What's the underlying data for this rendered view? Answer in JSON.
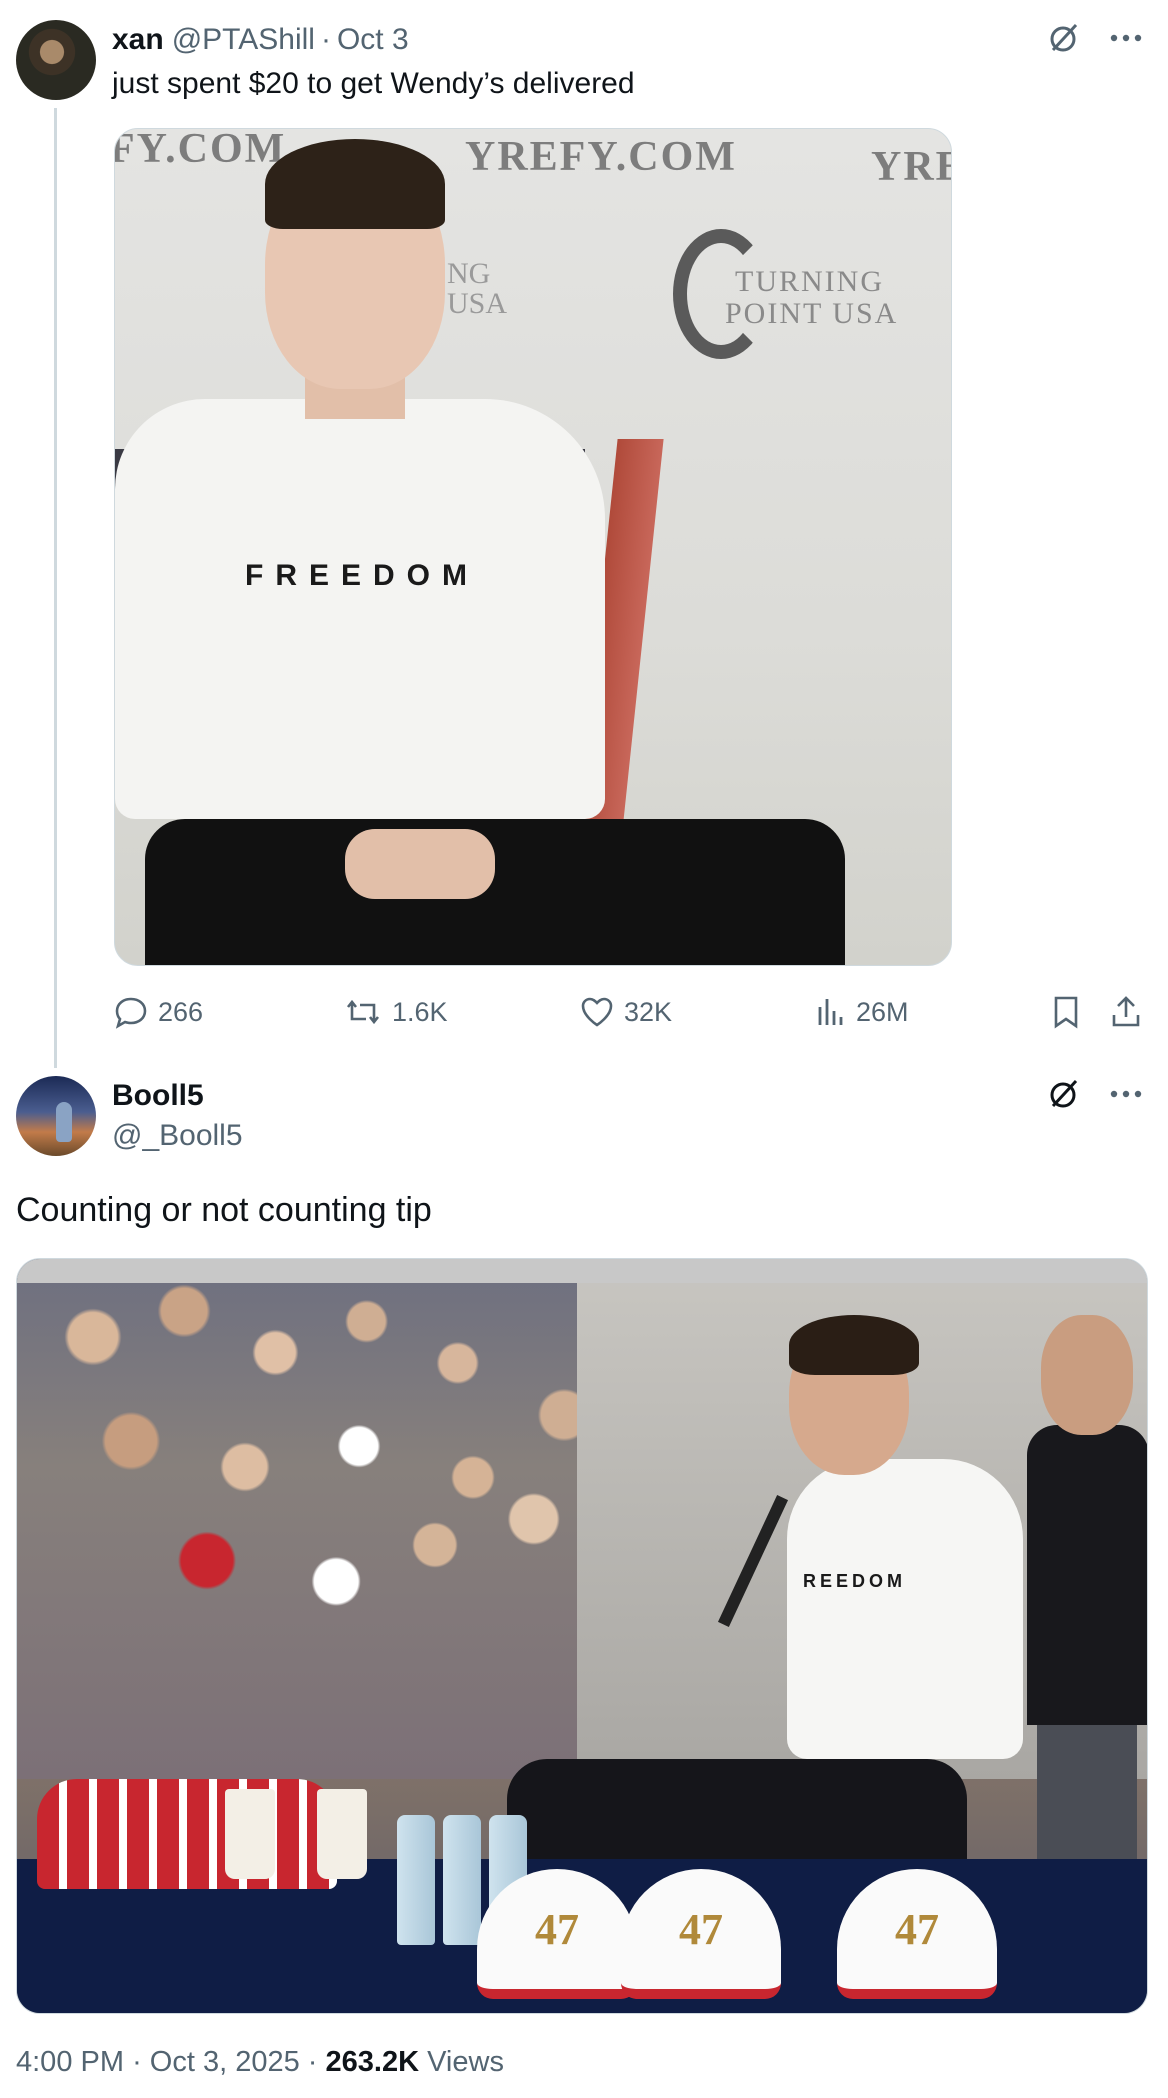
{
  "tweet1": {
    "name": "xan",
    "handle": "@PTAShill",
    "separator": "·",
    "date": "Oct 3",
    "text": "just spent $20 to get Wendy’s delivered",
    "media": {
      "banner_left": "FY.COM",
      "banner_mid": "YREFY.COM",
      "banner_right": "YRE",
      "tpusa_line1": "TURNING",
      "tpusa_line2": "POINT USA",
      "tpusa_partial_line1": "NG",
      "tpusa_partial_line2": "USA",
      "shirt_text": "FREEDOM"
    },
    "actions": {
      "replies": "266",
      "reposts": "1.6K",
      "likes": "32K",
      "views": "26M"
    }
  },
  "tweet2": {
    "name": "Booll5",
    "handle": "@_Booll5",
    "text": "Counting or not counting tip",
    "media": {
      "shirt_text": "REEDOM",
      "cap_label": "47"
    },
    "footer": {
      "time": "4:00 PM",
      "separator": "·",
      "date": "Oct 3, 2025",
      "views_count": "263.2K",
      "views_label": "Views"
    }
  },
  "icons": {
    "grok": "grok-icon",
    "more": "more-icon",
    "reply": "reply-icon",
    "repost": "repost-icon",
    "like": "heart-icon",
    "views": "analytics-icon",
    "bookmark": "bookmark-icon",
    "share": "share-icon"
  },
  "colors": {
    "text_primary": "#0f1419",
    "text_secondary": "#536471",
    "border": "#cfd9de"
  }
}
